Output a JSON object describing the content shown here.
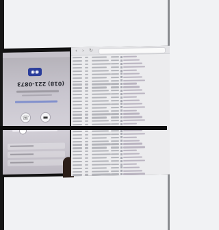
{
  "phone": {
    "call_icon": "phone-call-badge-icon",
    "number": "(018) 221-0873",
    "caller_name": "",
    "caller_link": "",
    "actions": [
      {
        "icon": "phone-handset-icon",
        "glyph": "☏"
      },
      {
        "icon": "message-icon",
        "glyph": "▬"
      }
    ],
    "option_rows": 3
  },
  "browser": {
    "nav_icons": [
      "back-icon",
      "forward-icon",
      "reload-icon"
    ],
    "url": "",
    "rows": 36
  },
  "colors": {
    "phone_bg": "#c9c6cf",
    "browser_bg": "#ececee",
    "badge": "#2a3d9b"
  }
}
